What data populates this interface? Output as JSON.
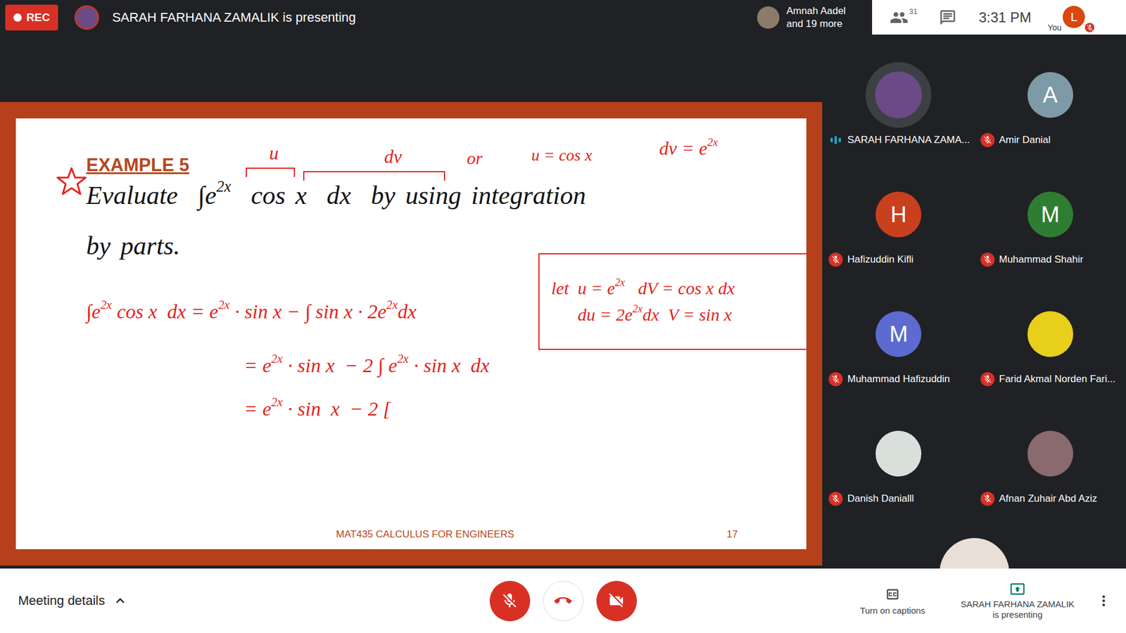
{
  "topbar": {
    "rec": "REC",
    "title": "SARAH FARHANA ZAMALIK is presenting",
    "others_chip": {
      "line1": "Amnah Aadel",
      "line2": "and 19 more"
    },
    "people_count": "31",
    "time": "3:31 PM",
    "you": {
      "label": "You",
      "initial": "L",
      "muted": true
    }
  },
  "slide": {
    "title": "EXAMPLE 5",
    "problem": [
      [
        {
          "text": "Evaluate  ∫e",
          "kind": "base"
        },
        {
          "text": "2x",
          "kind": "sup"
        },
        {
          "text": "  cos x  dx  by using integration",
          "kind": "base"
        }
      ],
      [
        {
          "text": "by parts.",
          "kind": "base"
        }
      ]
    ],
    "annotations": [
      [
        {
          "text": "u",
          "kind": "base"
        }
      ],
      [
        {
          "text": "dv",
          "kind": "base"
        }
      ],
      [
        {
          "text": "or",
          "kind": "base"
        }
      ],
      [
        {
          "text": "u = cos x",
          "kind": "base"
        }
      ],
      [
        {
          "text": "dv = e",
          "kind": "base"
        },
        {
          "text": "2x",
          "kind": "sup"
        }
      ]
    ],
    "box": [
      [
        {
          "text": "let  u = e",
          "kind": "base"
        },
        {
          "text": "2x",
          "kind": "sup"
        },
        {
          "text": "   dV = cos x dx",
          "kind": "base"
        }
      ],
      [
        {
          "text": "      du = 2e",
          "kind": "base"
        },
        {
          "text": "2x",
          "kind": "sup"
        },
        {
          "text": "dx  V = sin x",
          "kind": "base"
        }
      ]
    ],
    "work": [
      [
        {
          "text": "∫e",
          "kind": "base"
        },
        {
          "text": "2x",
          "kind": "sup"
        },
        {
          "text": " cos x  dx = e",
          "kind": "base"
        },
        {
          "text": "2x",
          "kind": "sup"
        },
        {
          "text": " · sin x − ∫ sin x · 2e",
          "kind": "base"
        },
        {
          "text": "2x",
          "kind": "sup"
        },
        {
          "text": "dx",
          "kind": "base"
        }
      ],
      [
        {
          "text": "= e",
          "kind": "base"
        },
        {
          "text": "2x",
          "kind": "sup"
        },
        {
          "text": " · sin x  − 2 ∫ e",
          "kind": "base"
        },
        {
          "text": "2x",
          "kind": "sup"
        },
        {
          "text": " · sin x  dx",
          "kind": "base"
        }
      ],
      [
        {
          "text": "= e",
          "kind": "base"
        },
        {
          "text": "2x",
          "kind": "sup"
        },
        {
          "text": " · sin  x  − 2 [",
          "kind": "base"
        }
      ]
    ],
    "footer": "MAT435 CALCULUS FOR ENGINEERS",
    "page": "17"
  },
  "participants": [
    {
      "name": "SARAH FARHANA ZAMA...",
      "kind": "photo",
      "color": "#6b4a86",
      "muted": false,
      "speaking": true
    },
    {
      "name": "Amir Danial",
      "kind": "initial",
      "initial": "A",
      "color": "#7d9aa6",
      "muted": true,
      "speaking": false
    },
    {
      "name": "Hafizuddin Kifli",
      "kind": "initial",
      "initial": "H",
      "color": "#c9401f",
      "muted": true,
      "speaking": false
    },
    {
      "name": "Muhammad Shahir",
      "kind": "initial",
      "initial": "M",
      "color": "#2f7d32",
      "muted": true,
      "speaking": false
    },
    {
      "name": "Muhammad Hafizuddin",
      "kind": "initial",
      "initial": "M",
      "color": "#5c6bd0",
      "muted": true,
      "speaking": false
    },
    {
      "name": "Farid Akmal Norden Fari...",
      "kind": "photo",
      "color": "#e8cf1c",
      "muted": true,
      "speaking": false
    },
    {
      "name": "Danish Danialll",
      "kind": "photo",
      "color": "#d9e0dc",
      "muted": true,
      "speaking": false
    },
    {
      "name": "Afnan Zuhair Abd Aziz",
      "kind": "photo",
      "color": "#8a6a6e",
      "muted": true,
      "speaking": false
    },
    {
      "kind": "photo",
      "color": "#eadfd6"
    }
  ],
  "bottombar": {
    "meeting_details": "Meeting details",
    "mic": {
      "muted": true
    },
    "camera": {
      "off": true
    },
    "captions": "Turn on captions",
    "presenting": {
      "line1": "SARAH FARHANA ZAMALIK",
      "line2": "is presenting"
    }
  }
}
